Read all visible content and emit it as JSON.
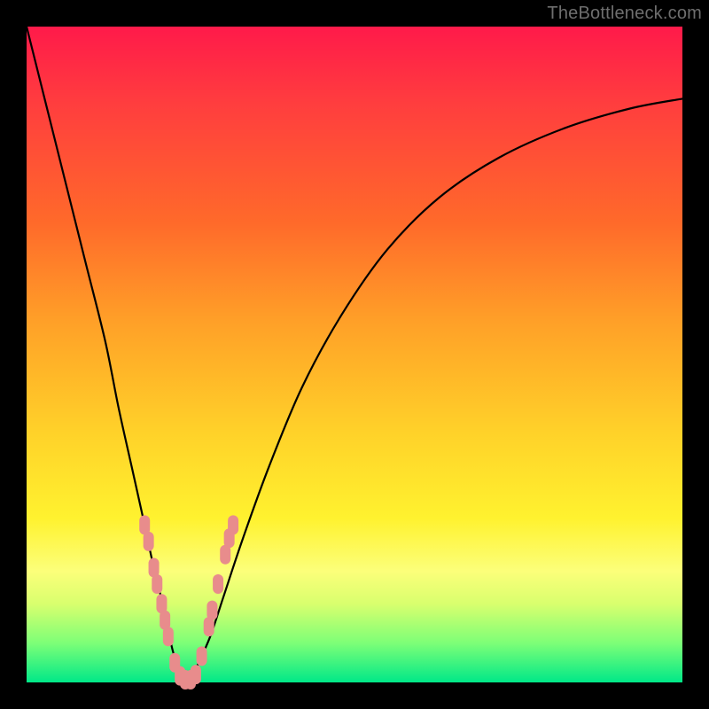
{
  "watermark": "TheBottleneck.com",
  "chart_data": {
    "type": "line",
    "title": "",
    "xlabel": "",
    "ylabel": "",
    "xlim": [
      0,
      100
    ],
    "ylim": [
      0,
      100
    ],
    "series": [
      {
        "name": "bottleneck-curve",
        "x": [
          0,
          3,
          6,
          9,
          12,
          14,
          16,
          18,
          19.5,
          21,
          22,
          23,
          24,
          25,
          26,
          28,
          30,
          33,
          37,
          42,
          48,
          55,
          63,
          72,
          82,
          92,
          100
        ],
        "values": [
          100,
          88,
          76,
          64,
          52,
          42,
          33,
          24,
          17,
          11,
          6,
          2.5,
          0.5,
          0.5,
          2.5,
          7,
          13,
          22,
          33,
          45,
          56,
          66,
          74,
          80,
          84.5,
          87.5,
          89
        ]
      }
    ],
    "markers": {
      "name": "highlighted-segments",
      "color": "#e88c8c",
      "points": [
        {
          "x": 18.0,
          "y": 24.0
        },
        {
          "x": 18.6,
          "y": 21.5
        },
        {
          "x": 19.4,
          "y": 17.5
        },
        {
          "x": 19.9,
          "y": 15.0
        },
        {
          "x": 20.6,
          "y": 12.0
        },
        {
          "x": 21.1,
          "y": 9.5
        },
        {
          "x": 21.6,
          "y": 7.0
        },
        {
          "x": 22.6,
          "y": 3.0
        },
        {
          "x": 23.4,
          "y": 1.0
        },
        {
          "x": 24.2,
          "y": 0.4
        },
        {
          "x": 25.0,
          "y": 0.4
        },
        {
          "x": 25.8,
          "y": 1.2
        },
        {
          "x": 26.7,
          "y": 4.0
        },
        {
          "x": 27.8,
          "y": 8.5
        },
        {
          "x": 28.3,
          "y": 11.0
        },
        {
          "x": 29.2,
          "y": 15.0
        },
        {
          "x": 30.3,
          "y": 19.5
        },
        {
          "x": 30.9,
          "y": 22.0
        },
        {
          "x": 31.5,
          "y": 24.0
        }
      ]
    },
    "background_gradient": {
      "top": "#ff1a4a",
      "upper_mid": "#ffa028",
      "mid": "#fff22f",
      "bottom": "#00e888"
    }
  }
}
